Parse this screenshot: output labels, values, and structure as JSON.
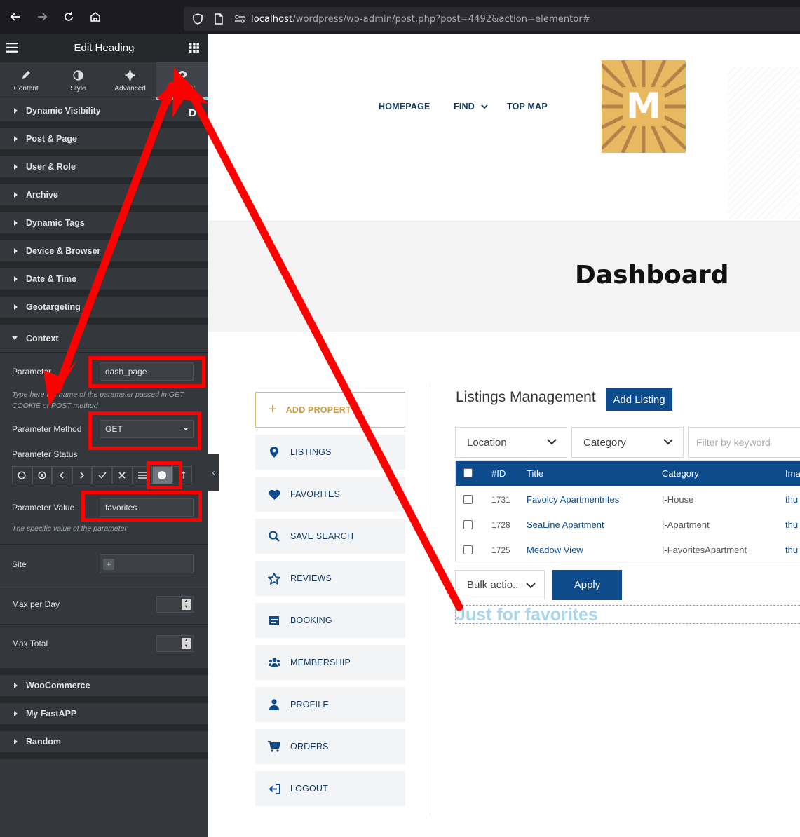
{
  "browser": {
    "url_host": "localhost",
    "url_path": "/wordpress/wp-admin/post.php?post=4492&action=elementor#"
  },
  "sidebar": {
    "title": "Edit Heading",
    "tabs": [
      {
        "label": "Content"
      },
      {
        "label": "Style"
      },
      {
        "label": "Advanced"
      },
      {
        "label": "Visibility"
      }
    ],
    "badge": "D",
    "sections_top": [
      {
        "label": "Dynamic Visibility"
      },
      {
        "label": "Post & Page"
      },
      {
        "label": "User & Role"
      },
      {
        "label": "Archive"
      },
      {
        "label": "Dynamic Tags"
      },
      {
        "label": "Device & Browser"
      },
      {
        "label": "Date & Time"
      },
      {
        "label": "Geotargeting"
      }
    ],
    "context": {
      "label": "Context",
      "parameter_label": "Parameter",
      "parameter_value": "dash_page",
      "parameter_hint": "Type here the name of the parameter passed in GET, COOKIE or POST method",
      "method_label": "Parameter Method",
      "method_value": "GET",
      "status_label": "Parameter Status",
      "param_value_label": "Parameter Value",
      "param_value": "favorites",
      "param_value_hint": "The specific value of the parameter",
      "site_label": "Site",
      "site_add": "+",
      "max_day_label": "Max per Day",
      "max_total_label": "Max Total"
    },
    "sections_bottom": [
      {
        "label": "WooCommerce"
      },
      {
        "label": "My FastAPP"
      },
      {
        "label": "Random"
      }
    ]
  },
  "site": {
    "nav": {
      "homepage": "HOMEPAGE",
      "find": "FIND",
      "top_map": "TOP MAP"
    },
    "logo_letter": "M",
    "dashboard_title": "Dashboard",
    "menu": {
      "add_property": "ADD PROPERTY",
      "items": [
        {
          "label": "LISTINGS"
        },
        {
          "label": "FAVORITES"
        },
        {
          "label": "SAVE SEARCH"
        },
        {
          "label": "REVIEWS"
        },
        {
          "label": "BOOKING"
        },
        {
          "label": "MEMBERSHIP"
        },
        {
          "label": "PROFILE"
        },
        {
          "label": "ORDERS"
        },
        {
          "label": "LOGOUT"
        }
      ]
    },
    "listings": {
      "title": "Listings Management",
      "add_button": "Add Listing",
      "location_select": "Location",
      "category_select": "Category",
      "filter_placeholder": "Filter by keyword",
      "columns": {
        "id": "#ID",
        "title": "Title",
        "category": "Category",
        "image": "Ima"
      },
      "rows": [
        {
          "id": "1731",
          "title": "Favolcy Apartmentrites",
          "category": "|-House",
          "image": "thu"
        },
        {
          "id": "1728",
          "title": "SeaLine Apartment",
          "category": "|-Apartment",
          "image": "thu"
        },
        {
          "id": "1725",
          "title": "Meadow View",
          "category": "|-FavoritesApartment",
          "image": "thu"
        }
      ],
      "bulk_select": "Bulk actio..",
      "apply_button": "Apply"
    },
    "heading_text": "Just for favorites"
  },
  "colors": {
    "brand_blue": "#0e4b8c",
    "annotation_red": "#ff0000",
    "elementor_panel": "#34383c",
    "accent_gold": "#c79a4a"
  }
}
